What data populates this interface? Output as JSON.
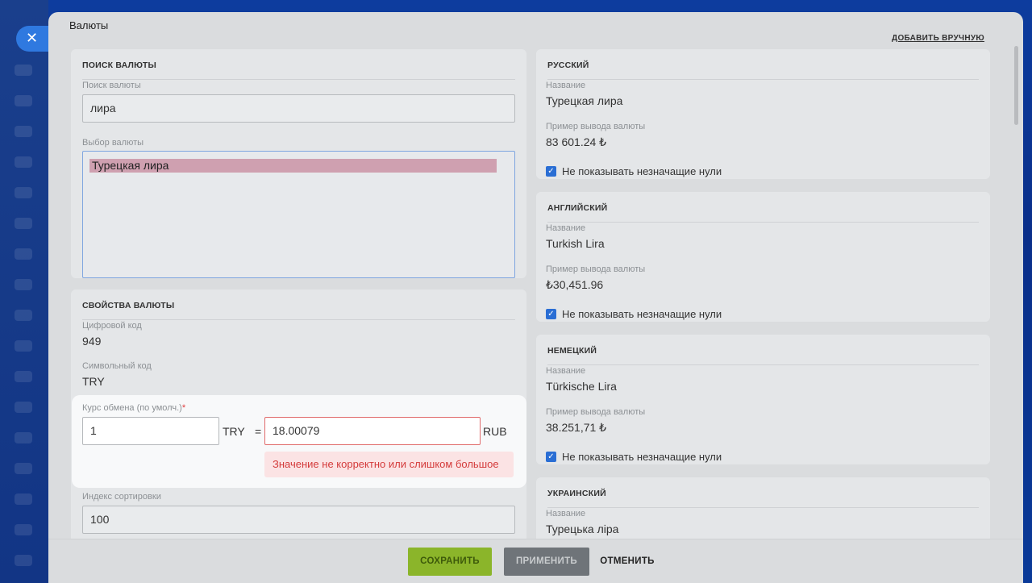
{
  "slider": {
    "title": "Валюты",
    "add_manual": "ДОБАВИТЬ ВРУЧНУЮ",
    "close_icon": "close-icon"
  },
  "search_card": {
    "title": "ПОИСК ВАЛЮТЫ",
    "search_label": "Поиск валюты",
    "search_value": "лира",
    "select_label": "Выбор валюты",
    "select_options": [
      "Турецкая лира"
    ]
  },
  "props_card": {
    "title": "СВОЙСТВА ВАЛЮТЫ",
    "numeric_code_label": "Цифровой код",
    "numeric_code": "949",
    "symbol_code_label": "Символьный код",
    "symbol_code": "TRY",
    "rate_label": "Курс обмена (по умолч.)",
    "required_mark": "*",
    "rate_amount": "1",
    "rate_from": "TRY",
    "equals": "=",
    "rate_value": "18.00079",
    "rate_to": "RUB",
    "error": "Значение не корректно или слишком большое",
    "sort_label": "Индекс сортировки",
    "sort_value": "100"
  },
  "langs": [
    {
      "title": "РУССКИЙ",
      "name_label": "Название",
      "name": "Турецкая лира",
      "example_label": "Пример вывода валюты",
      "example": "83 601.24 ₺",
      "hide_zeros": "Не показывать незначащие нули"
    },
    {
      "title": "АНГЛИЙСКИЙ",
      "name_label": "Название",
      "name": "Turkish Lira",
      "example_label": "Пример вывода валюты",
      "example": "₺30,451.96",
      "hide_zeros": "Не показывать незначащие нули"
    },
    {
      "title": "НЕМЕЦКИЙ",
      "name_label": "Название",
      "name": "Türkische Lira",
      "example_label": "Пример вывода валюты",
      "example": "38.251,71 ₺",
      "hide_zeros": "Не показывать незначащие нули"
    },
    {
      "title": "УКРАИНСКИЙ",
      "name_label": "Название",
      "name": "Турецька ліра"
    }
  ],
  "footer": {
    "save": "СОХРАНИТЬ",
    "apply": "ПРИМЕНИТЬ",
    "cancel": "ОТМЕНИТЬ"
  }
}
